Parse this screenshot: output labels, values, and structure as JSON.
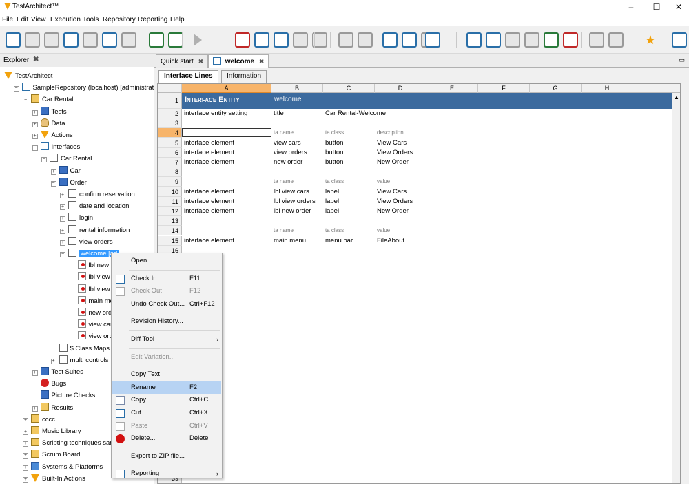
{
  "window": {
    "title": "TestArchitect™",
    "min": "–",
    "max": "☐",
    "close": "✕"
  },
  "menu": [
    "File",
    "Edit",
    "View",
    "Execution",
    "Tools",
    "Repository",
    "Reporting",
    "Help"
  ],
  "toolbar": {
    "icons": [
      "new-icon",
      "save-icon",
      "save-all-icon",
      "check-in-icon",
      "check-out-icon",
      "refresh-icon",
      "search-icon",
      "add-test-icon",
      "add-interface-icon",
      "run-icon",
      "record-icon",
      "stop-icon",
      "step-icon",
      "capture-icon",
      "camera-icon",
      "breakpoint-icon",
      "ident-icon",
      "copy-icon",
      "cut-icon",
      "paste-icon",
      "undo-icon",
      "redo-icon",
      "find-icon",
      "comment-icon",
      "uncomment-icon",
      "grid-add-icon",
      "grid-remove-icon",
      "debug-icon",
      "debug2-icon",
      "star-icon",
      "help-icon"
    ]
  },
  "explorer": {
    "tab": "Explorer",
    "close": "✖",
    "tree": [
      {
        "label": "TestArchitect",
        "icon": "testarchitect-icon",
        "indent": 0,
        "exp": ""
      },
      {
        "label": "SampleRepository (localhost) [administrato",
        "icon": "repository-icon",
        "indent": 1,
        "exp": "−"
      },
      {
        "label": "Car Rental",
        "icon": "project-icon",
        "indent": 2,
        "exp": "−"
      },
      {
        "label": "Tests",
        "icon": "tests-icon",
        "indent": 3,
        "exp": "+"
      },
      {
        "label": "Data",
        "icon": "data-icon",
        "indent": 3,
        "exp": "+"
      },
      {
        "label": "Actions",
        "icon": "actions-icon",
        "indent": 3,
        "exp": "+"
      },
      {
        "label": "Interfaces",
        "icon": "interfaces-icon",
        "indent": 3,
        "exp": "−"
      },
      {
        "label": "Car Rental",
        "icon": "interface-folder-icon",
        "indent": 4,
        "exp": "−"
      },
      {
        "label": "Car",
        "icon": "folder-icon",
        "indent": 5,
        "exp": "+"
      },
      {
        "label": "Order",
        "icon": "folder-icon",
        "indent": 5,
        "exp": "−"
      },
      {
        "label": "confirm reservation",
        "icon": "interface-entity-icon",
        "indent": 6,
        "exp": "+"
      },
      {
        "label": "date and location",
        "icon": "interface-entity-icon",
        "indent": 6,
        "exp": "+"
      },
      {
        "label": "login",
        "icon": "interface-entity-icon",
        "indent": 6,
        "exp": "+"
      },
      {
        "label": "rental information",
        "icon": "interface-entity-icon",
        "indent": 6,
        "exp": "+"
      },
      {
        "label": "view orders",
        "icon": "interface-entity-icon",
        "indent": 6,
        "exp": "+"
      },
      {
        "label": "welcome [ad",
        "icon": "interface-entity-icon",
        "indent": 6,
        "exp": "−",
        "selected": true
      },
      {
        "label": "lbl new o",
        "icon": "interface-element-icon",
        "indent": 7,
        "exp": ""
      },
      {
        "label": "lbl view o",
        "icon": "interface-element-icon",
        "indent": 7,
        "exp": ""
      },
      {
        "label": "lbl view o",
        "icon": "interface-element-icon",
        "indent": 7,
        "exp": ""
      },
      {
        "label": "main men",
        "icon": "interface-element-icon",
        "indent": 7,
        "exp": ""
      },
      {
        "label": "new orde",
        "icon": "interface-element-icon",
        "indent": 7,
        "exp": ""
      },
      {
        "label": "view cars",
        "icon": "interface-element-icon",
        "indent": 7,
        "exp": ""
      },
      {
        "label": "view orde",
        "icon": "interface-element-icon",
        "indent": 7,
        "exp": ""
      },
      {
        "label": "$ Class Maps",
        "icon": "interface-entity-icon",
        "indent": 5,
        "exp": ""
      },
      {
        "label": "multi controls",
        "icon": "interface-entity-icon",
        "indent": 5,
        "exp": "+"
      },
      {
        "label": "Test Suites",
        "icon": "test-suites-icon",
        "indent": 3,
        "exp": "+"
      },
      {
        "label": "Bugs",
        "icon": "bug-icon",
        "indent": 3,
        "exp": ""
      },
      {
        "label": "Picture Checks",
        "icon": "picture-checks-icon",
        "indent": 3,
        "exp": ""
      },
      {
        "label": "Results",
        "icon": "results-icon",
        "indent": 3,
        "exp": "+"
      },
      {
        "label": "cccc",
        "icon": "project-icon",
        "indent": 2,
        "exp": "+"
      },
      {
        "label": "Music Library",
        "icon": "project-icon",
        "indent": 2,
        "exp": "+"
      },
      {
        "label": "Scripting techniques samp",
        "icon": "project-icon",
        "indent": 2,
        "exp": "+"
      },
      {
        "label": "Scrum Board",
        "icon": "project-icon",
        "indent": 2,
        "exp": "+"
      },
      {
        "label": "Systems & Platforms",
        "icon": "systems-icon",
        "indent": 2,
        "exp": "+"
      },
      {
        "label": "Built-In Actions",
        "icon": "builtin-actions-icon",
        "indent": 2,
        "exp": "+"
      }
    ]
  },
  "tabs": [
    {
      "label": "Quick start",
      "close": "✖"
    },
    {
      "label": "welcome",
      "close": "✖",
      "active": true
    }
  ],
  "maximize": "▭",
  "subtabs": [
    "Interface Lines",
    "Information"
  ],
  "sheet": {
    "columns": [
      "A",
      "B",
      "C",
      "D",
      "E",
      "F",
      "G",
      "H",
      "I"
    ],
    "header": {
      "rownum": "1",
      "a": "Interface Entity",
      "b": "welcome"
    },
    "rows": [
      {
        "n": "2",
        "a": "interface entity setting",
        "b": "title",
        "c": "Car Rental-Welcome",
        "d": ""
      },
      {
        "n": "3",
        "a": "",
        "b": "",
        "c": "",
        "d": ""
      },
      {
        "n": "4",
        "a": "",
        "b": "ta name",
        "c": "ta class",
        "d": "description",
        "small": true,
        "active": true
      },
      {
        "n": "5",
        "a": "interface element",
        "b": "view cars",
        "c": "button",
        "d": "View Cars"
      },
      {
        "n": "6",
        "a": "interface element",
        "b": "view orders",
        "c": "button",
        "d": "View Orders"
      },
      {
        "n": "7",
        "a": "interface element",
        "b": "new order",
        "c": "button",
        "d": "New Order"
      },
      {
        "n": "8",
        "a": "",
        "b": "",
        "c": "",
        "d": ""
      },
      {
        "n": "9",
        "a": "",
        "b": "ta name",
        "c": "ta class",
        "d": "value",
        "small": true
      },
      {
        "n": "10",
        "a": "interface element",
        "b": "lbl view cars",
        "c": "label",
        "d": "View Cars"
      },
      {
        "n": "11",
        "a": "interface element",
        "b": "lbl view orders",
        "c": "label",
        "d": "View Orders"
      },
      {
        "n": "12",
        "a": "interface element",
        "b": "lbl new order",
        "c": "label",
        "d": "New Order"
      },
      {
        "n": "13",
        "a": "",
        "b": "",
        "c": "",
        "d": ""
      },
      {
        "n": "14",
        "a": "",
        "b": "ta name",
        "c": "ta class",
        "d": "value",
        "small": true
      },
      {
        "n": "15",
        "a": "interface element",
        "b": "main menu",
        "c": "menu bar",
        "d": "FileAbout"
      },
      {
        "n": "16",
        "a": "",
        "b": "",
        "c": "",
        "d": ""
      }
    ],
    "bottom_row": "39"
  },
  "context_menu": [
    {
      "label": "Open",
      "shortcut": "",
      "icon": "",
      "disabled": false
    },
    {
      "sep": true
    },
    {
      "label": "Check In...",
      "shortcut": "F11",
      "icon": "check-in-icon",
      "disabled": false
    },
    {
      "label": "Check Out",
      "shortcut": "F12",
      "icon": "check-out-icon",
      "disabled": true
    },
    {
      "label": "Undo Check Out...",
      "shortcut": "Ctrl+F12",
      "icon": "",
      "disabled": false
    },
    {
      "sep": true
    },
    {
      "label": "Revision History...",
      "shortcut": "",
      "icon": "",
      "disabled": false
    },
    {
      "sep": true
    },
    {
      "label": "Diff Tool",
      "shortcut": "",
      "icon": "",
      "disabled": false,
      "sub": "›"
    },
    {
      "sep": true
    },
    {
      "label": "Edit Variation...",
      "shortcut": "",
      "icon": "",
      "disabled": true
    },
    {
      "sep": true
    },
    {
      "label": "Copy Text",
      "shortcut": "",
      "icon": "",
      "disabled": false
    },
    {
      "label": "Rename",
      "shortcut": "F2",
      "icon": "",
      "disabled": false,
      "hl": true
    },
    {
      "label": "Copy",
      "shortcut": "Ctrl+C",
      "icon": "copy-icon",
      "disabled": false
    },
    {
      "label": "Cut",
      "shortcut": "Ctrl+X",
      "icon": "cut-icon",
      "disabled": false
    },
    {
      "label": "Paste",
      "shortcut": "Ctrl+V",
      "icon": "paste-icon",
      "disabled": true
    },
    {
      "label": "Delete...",
      "shortcut": "Delete",
      "icon": "delete-icon",
      "disabled": false
    },
    {
      "sep": true
    },
    {
      "label": "Export to ZIP file...",
      "shortcut": "",
      "icon": "",
      "disabled": false
    },
    {
      "sep": true
    },
    {
      "label": "Reporting",
      "shortcut": "",
      "icon": "reporting-icon",
      "disabled": false,
      "sub": "›"
    }
  ],
  "colors": {
    "header_blue": "#3b6a9e",
    "active_orange": "#f7b46a",
    "selection": "#3399ff",
    "menu_highlight": "#b7d3f3"
  }
}
